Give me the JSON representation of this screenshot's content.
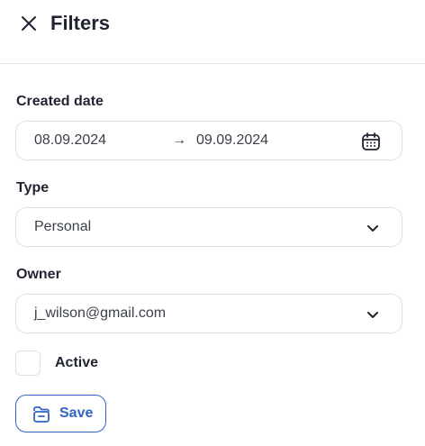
{
  "header": {
    "title": "Filters",
    "close_icon": "close-icon"
  },
  "created_date": {
    "label": "Created date",
    "from": "08.09.2024",
    "arrow": "→",
    "to": "09.09.2024",
    "icon": "calendar-icon"
  },
  "type": {
    "label": "Type",
    "value": "Personal",
    "icon": "chevron-down-icon"
  },
  "owner": {
    "label": "Owner",
    "value": "j_wilson@gmail.com",
    "icon": "chevron-down-icon"
  },
  "active": {
    "label": "Active",
    "checked": false
  },
  "save": {
    "label": "Save",
    "icon": "folder-icon"
  },
  "colors": {
    "accent": "#2f64c8",
    "text": "#1f2430",
    "border": "#dde0e5"
  }
}
